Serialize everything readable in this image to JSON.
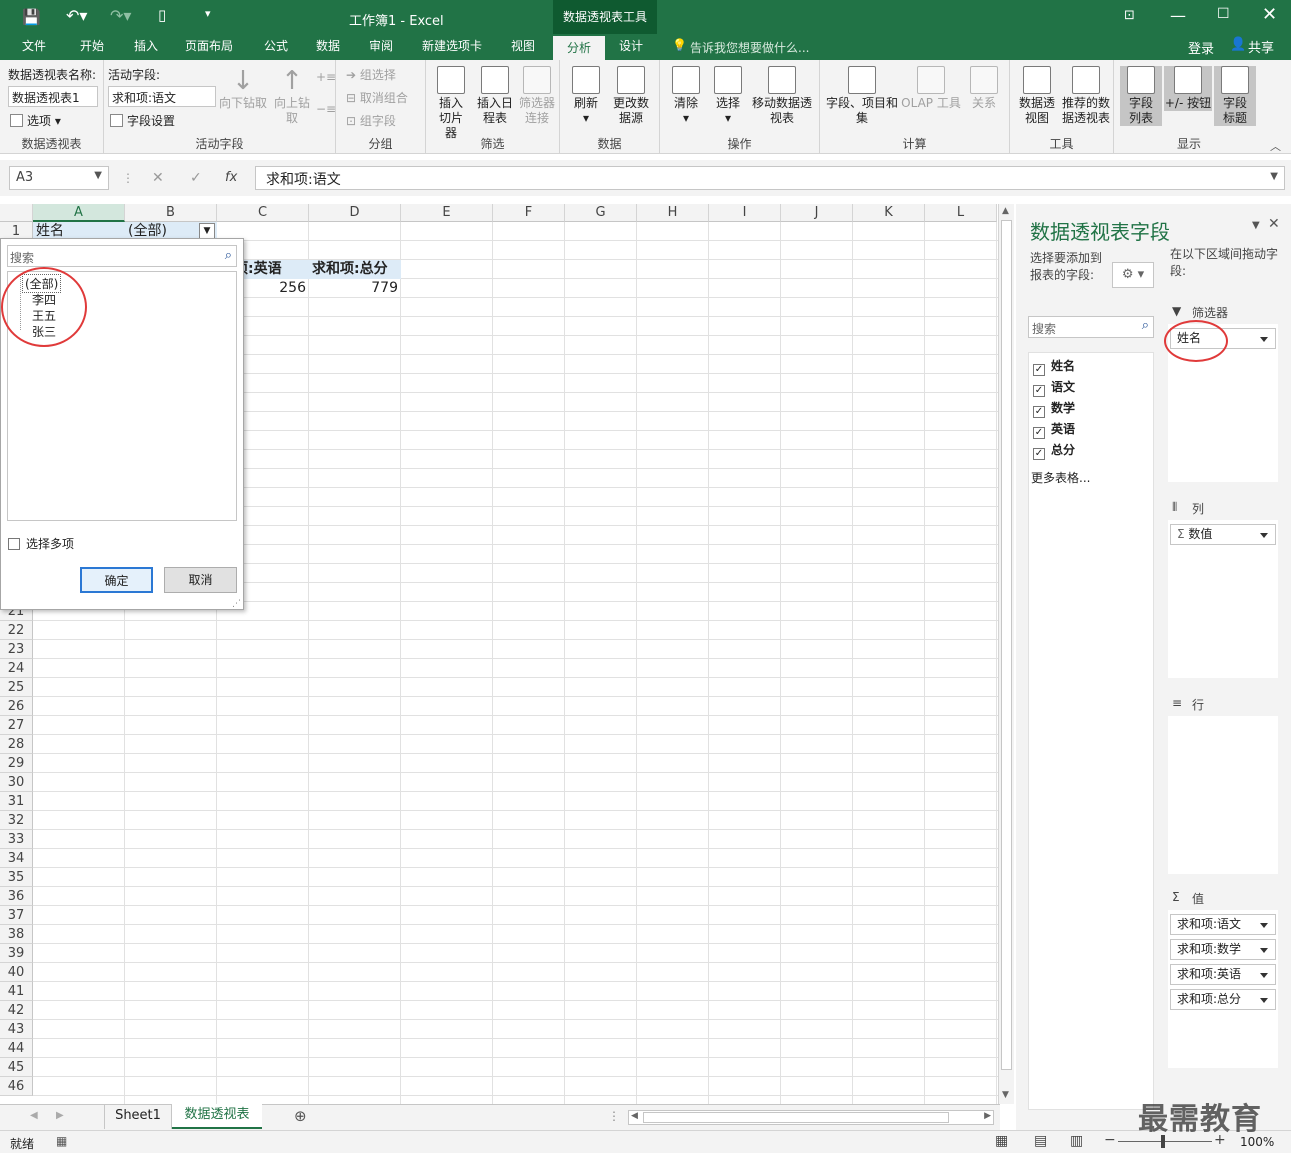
{
  "window": {
    "title": "工作簿1 - Excel",
    "context_tab": "数据透视表工具",
    "login": "登录",
    "share": "共享"
  },
  "tabs": [
    "文件",
    "开始",
    "插入",
    "页面布局",
    "公式",
    "数据",
    "审阅",
    "新建选项卡",
    "视图",
    "分析",
    "设计"
  ],
  "tell_me": "告诉我您想要做什么...",
  "ribbon": {
    "pivot": {
      "name_label": "数据透视表名称:",
      "name_value": "数据透视表1",
      "options": "选项",
      "group": "数据透视表"
    },
    "active": {
      "label": "活动字段:",
      "value": "求和项:语文",
      "settings": "字段设置",
      "drill_down": "向下钻取",
      "drill_up": "向上钻取",
      "group": "活动字段"
    },
    "grouping": {
      "sel": "组选择",
      "ungroup": "取消组合",
      "field": "组字段",
      "group": "分组"
    },
    "filter": {
      "slicer": "插入切片器",
      "timeline": "插入日程表",
      "conn": "筛选器连接",
      "group": "筛选"
    },
    "data": {
      "refresh": "刷新",
      "change": "更改数据源",
      "group": "数据"
    },
    "actions": {
      "clear": "清除",
      "select": "选择",
      "move": "移动数据透视表",
      "group": "操作"
    },
    "calc": {
      "fields": "字段、项目和集",
      "olap": "OLAP 工具",
      "rel": "关系",
      "group": "计算"
    },
    "tools": {
      "chart": "数据透视图",
      "recommend": "推荐的数据透视表",
      "group": "工具"
    },
    "show": {
      "list": "字段列表",
      "buttons": "+/- 按钮",
      "headers": "字段标题",
      "group": "显示"
    }
  },
  "formula_bar": {
    "cell_ref": "A3",
    "fx": "fx",
    "content": "求和项:语文"
  },
  "columns": [
    "A",
    "B",
    "C",
    "D",
    "E",
    "F",
    "G",
    "H",
    "I",
    "J",
    "K",
    "L"
  ],
  "cells": {
    "a1": "姓名",
    "b1": "(全部)",
    "c3": "和项:英语",
    "d3": "求和项:总分",
    "c4": "256",
    "d4": "779"
  },
  "filter_popup": {
    "search_placeholder": "搜索",
    "items": [
      "(全部)",
      "李四",
      "王五",
      "张三"
    ],
    "multi": "选择多项",
    "ok": "确定",
    "cancel": "取消"
  },
  "panel": {
    "title": "数据透视表字段",
    "choose": "选择要添加到报表的字段:",
    "drag": "在以下区域间拖动字段:",
    "search": "搜索",
    "fields": [
      "姓名",
      "语文",
      "数学",
      "英语",
      "总分"
    ],
    "more": "更多表格...",
    "filters_label": "筛选器",
    "filter_items": [
      "姓名"
    ],
    "columns_label": "列",
    "column_items": [
      "数值"
    ],
    "rows_label": "行",
    "values_label": "值",
    "value_items": [
      "求和项:语文",
      "求和项:数学",
      "求和项:英语",
      "求和项:总分"
    ]
  },
  "sheets": [
    "Sheet1",
    "数据透视表"
  ],
  "status": {
    "ready": "就绪",
    "zoom": "100%"
  },
  "watermark": "最需教育"
}
